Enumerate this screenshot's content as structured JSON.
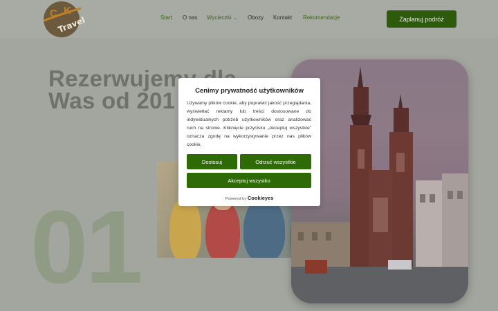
{
  "header": {
    "logo": {
      "letters": [
        "C",
        "K"
      ],
      "word": "Travel"
    },
    "nav": [
      {
        "label": "Start",
        "active": true
      },
      {
        "label": "O nas",
        "active": false
      },
      {
        "label": "Wycieczki",
        "active": true,
        "has_dropdown": true
      },
      {
        "label": "Obozy",
        "active": false
      },
      {
        "label": "Kontakt",
        "active": false
      },
      {
        "label": "Rekomendacje",
        "active": true
      }
    ],
    "cta_label": "Zaplanuj podróż"
  },
  "hero": {
    "title_line1": "Rezerwujemy dla",
    "title_line2": "Was od 201",
    "big_number": "01"
  },
  "cookie_dialog": {
    "title": "Cenimy prywatność użytkowników",
    "text": "Używamy plików cookie, aby poprawić jakość przeglądania, wyświetlać reklamy lub treści dostosowane do indywidualnych potrzeb użytkowników oraz analizować ruch na stronie. Kliknięcie przycisku „Akceptuj wszystkie” oznacza zgodę na wykorzystywanie przez nas plików cookie.",
    "buttons": {
      "customize": "Dostosuj",
      "reject": "Odrzuć wszystkie",
      "accept": "Akceptuj wszystko"
    },
    "powered_by": "Powered by",
    "brand": "Cookieyes"
  },
  "colors": {
    "accent_green": "#2e6a06",
    "cta_green": "#2e5a0b",
    "overlay": "#a3a69f"
  }
}
